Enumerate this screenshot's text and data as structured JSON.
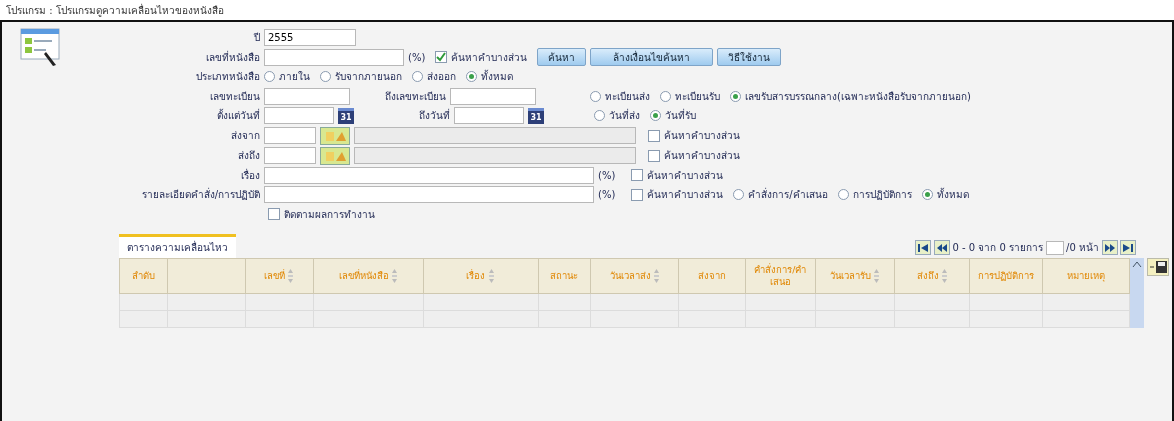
{
  "window": {
    "title": "โปรแกรม : โปรแกรมดูความเคลื่อนไหวของหนังสือ"
  },
  "form": {
    "year": {
      "label": "ปี",
      "value": "2555"
    },
    "doc_number": {
      "label": "เลขที่หนังสือ",
      "percent": "(%)",
      "partial": {
        "label": "ค้นหาคำบางส่วน",
        "checked": true
      }
    },
    "buttons": [
      "ค้นหา",
      "ล้างเงื่อนไขค้นหา",
      "วิธีใช้งาน"
    ],
    "doc_type": {
      "label": "ประเภทหนังสือ",
      "options": [
        {
          "label": "ภายใน",
          "selected": false
        },
        {
          "label": "รับจากภายนอก",
          "selected": false
        },
        {
          "label": "ส่งออก",
          "selected": false
        },
        {
          "label": "ทั้งหมด",
          "selected": true
        }
      ]
    },
    "register": {
      "label": "เลขทะเบียน",
      "to_label": "ถึงเลขทะเบียน",
      "options": [
        {
          "label": "ทะเบียนส่ง",
          "selected": false
        },
        {
          "label": "ทะเบียนรับ",
          "selected": false
        },
        {
          "label": "เลขรับสารบรรณกลาง(เฉพาะหนังสือรับจากภายนอก)",
          "selected": true
        }
      ]
    },
    "dates": {
      "label": "ตั้งแต่วันที่",
      "from_icon": "31",
      "to_label": "ถึงวันที่",
      "to_icon": "31",
      "options": [
        {
          "label": "วันที่ส่ง",
          "selected": false
        },
        {
          "label": "วันที่รับ",
          "selected": true
        }
      ]
    },
    "sender": {
      "label": "ส่งจาก",
      "partial": {
        "label": "ค้นหาคำบางส่วน",
        "checked": false
      }
    },
    "recipient": {
      "label": "ส่งถึง",
      "partial": {
        "label": "ค้นหาคำบางส่วน",
        "checked": false
      }
    },
    "subject": {
      "label": "เรื่อง",
      "percent": "(%)",
      "partial": {
        "label": "ค้นหาคำบางส่วน",
        "checked": false
      }
    },
    "detail": {
      "label": "รายละเอียดคำสั่ง/การปฏิบัติ",
      "percent": "(%)",
      "partial": {
        "label": "ค้นหาคำบางส่วน",
        "checked": false
      },
      "options": [
        {
          "label": "คำสั่งการ/คำเสนอ",
          "selected": false
        },
        {
          "label": "การปฏิบัติการ",
          "selected": false
        },
        {
          "label": "ทั้งหมด",
          "selected": true
        }
      ]
    },
    "follow_up": {
      "label": "ติดตามผลการทำงาน",
      "checked": false
    }
  },
  "table": {
    "tab": {
      "label": "ตารางความเคลื่อนไหว",
      "selected": true
    },
    "pager": {
      "range": "0 - 0 จาก 0 รายการ",
      "pages": "/0 หน้า"
    },
    "columns": [
      {
        "label": "ลำดับ",
        "sortable": false
      },
      {
        "sortable": false
      },
      {
        "label": "เลขที่",
        "sortable": true
      },
      {
        "label": "เลขที่หนังสือ",
        "sortable": true
      },
      {
        "label": "เรื่อง",
        "sortable": true
      },
      {
        "label": "สถานะ",
        "sortable": false
      },
      {
        "label": "วันเวลาส่ง",
        "sortable": true
      },
      {
        "label": "ส่งจาก",
        "sortable": false
      },
      {
        "label": "คำสั่งการ/คำเสนอ",
        "sortable": false
      },
      {
        "label": "วันเวลารับ",
        "sortable": true
      },
      {
        "label": "ส่งถึง",
        "sortable": true
      },
      {
        "label": "การปฏิบัติการ",
        "sortable": false
      },
      {
        "label": "หมายเหตุ",
        "sortable": false
      }
    ]
  }
}
